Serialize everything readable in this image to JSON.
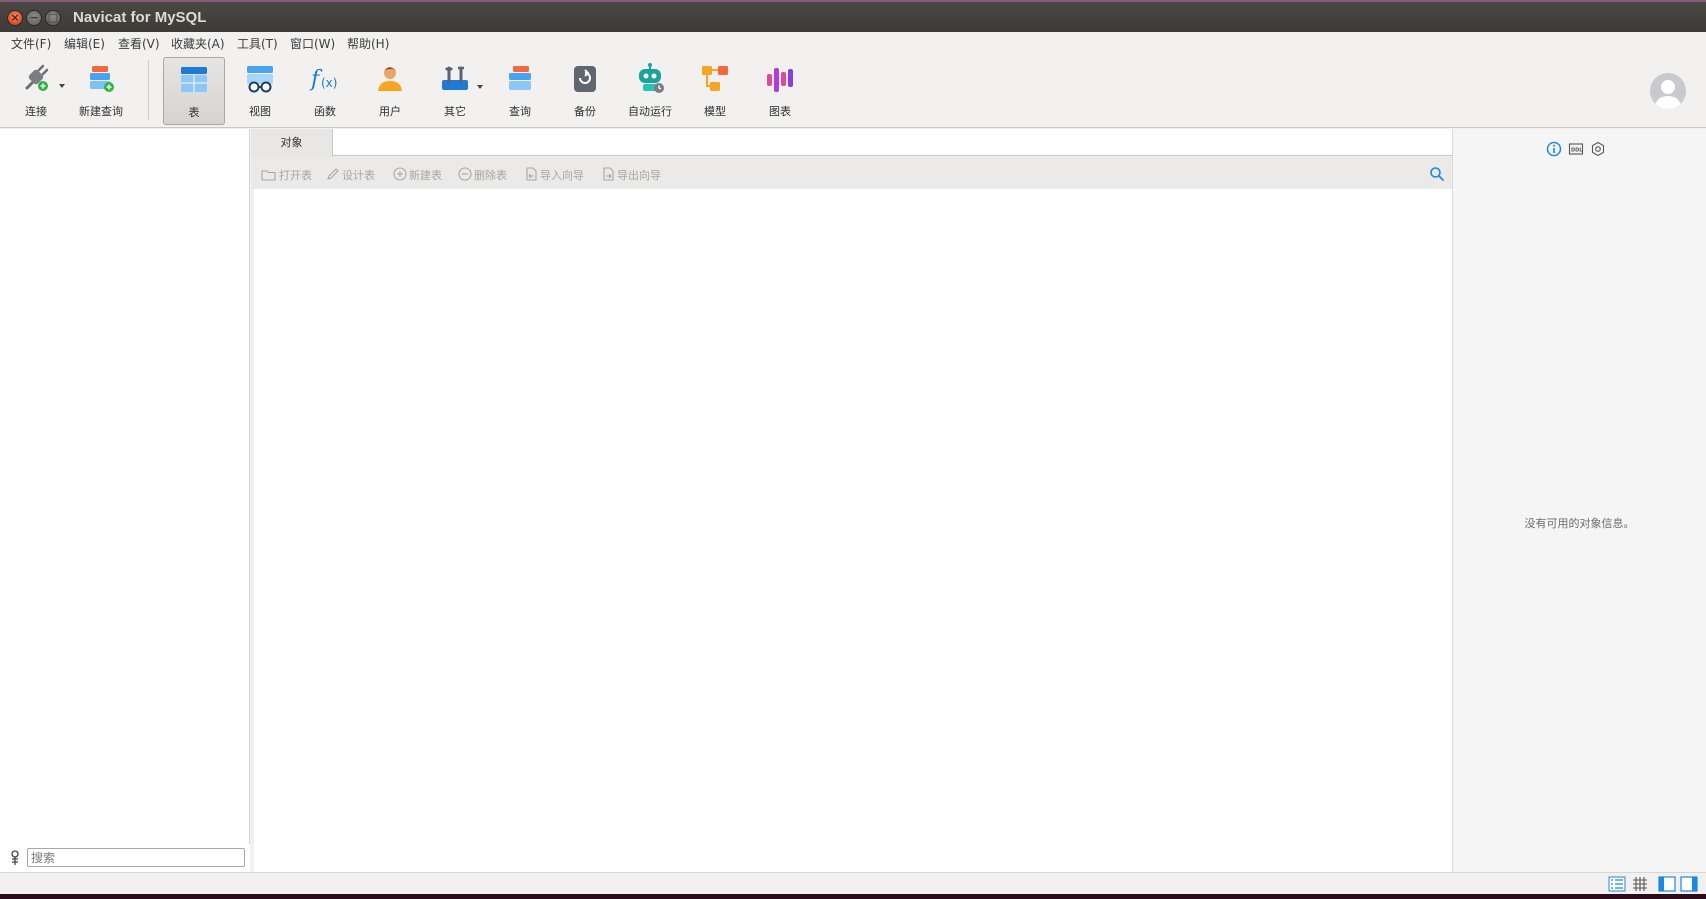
{
  "window": {
    "title": "Navicat for MySQL"
  },
  "menu": [
    "文件(F)",
    "编辑(E)",
    "查看(V)",
    "收藏夹(A)",
    "工具(T)",
    "窗口(W)",
    "帮助(H)"
  ],
  "toolbar": {
    "connect": "连接",
    "new_query": "新建查询",
    "table": "表",
    "view": "视图",
    "function": "函数",
    "user": "用户",
    "other": "其它",
    "query": "查询",
    "backup": "备份",
    "automation": "自动运行",
    "model": "模型",
    "chart": "图表"
  },
  "objects_tab": {
    "label": "对象"
  },
  "object_toolbar": {
    "open_table": "打开表",
    "design_table": "设计表",
    "new_table": "新建表",
    "delete_table": "删除表",
    "import_wizard": "导入向导",
    "export_wizard": "导出向导"
  },
  "left_search": {
    "placeholder": "搜索"
  },
  "info_panel": {
    "empty_message": "没有可用的对象信息。"
  },
  "colors": {
    "accent": "#1e88e5",
    "close_button": "#e2532a",
    "title_bar": "#3c3b37"
  }
}
